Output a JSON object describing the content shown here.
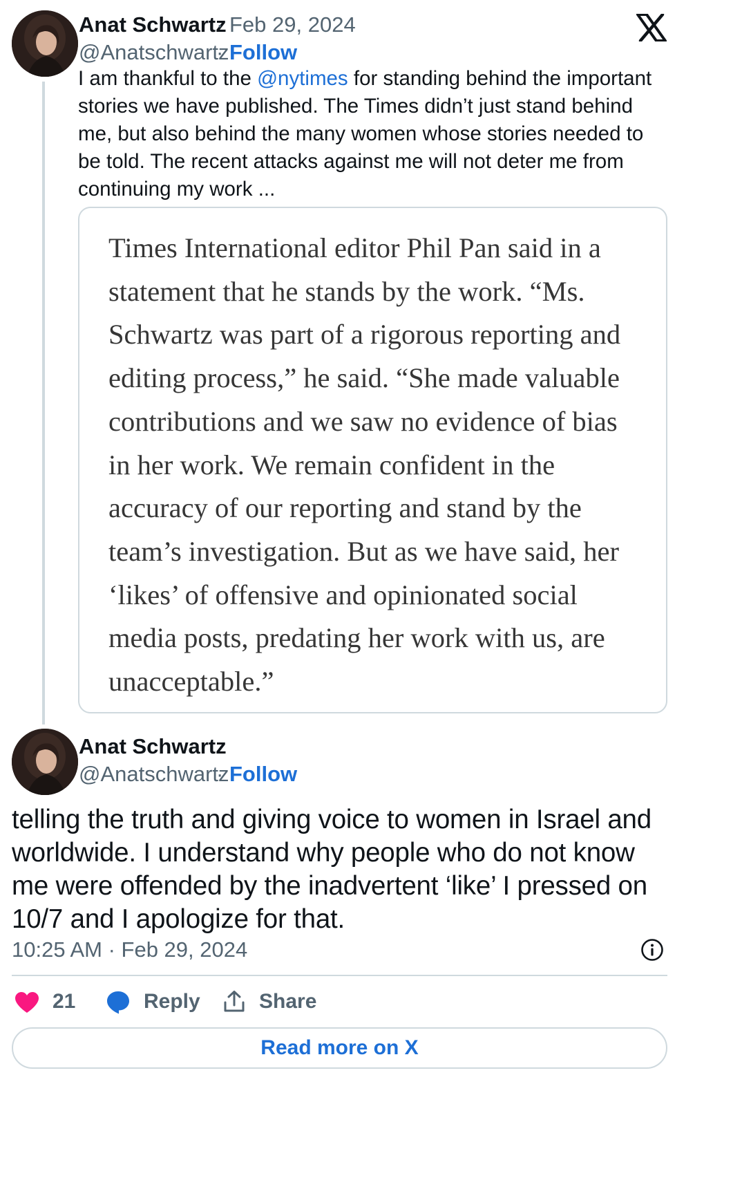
{
  "tweet1": {
    "author_name": "Anat Schwartz",
    "date": "Feb 29, 2024",
    "handle": "@Anatschwartz",
    "follow_label": "Follow",
    "text_before_mention": "I am thankful to the ",
    "mention": "@nytimes",
    "text_after_mention": " for standing behind the important stories we have published. The Times didn’t just stand behind me, but also behind the many women whose stories needed to be told. The recent attacks against me will not deter me from continuing my work ...",
    "quote_image_text": "Times International editor Phil Pan said in a statement that he stands by the work. “Ms. Schwartz was part of a rigorous reporting and editing process,” he said. “She made valuable contributions and we saw no evidence of bias in her work. We remain confident in the accuracy of our reporting and stand by the team’s investigation. But as we have said, her ‘likes’ of offensive and opinionated social media posts, predating her work with us, are unacceptable.”"
  },
  "tweet2": {
    "author_name": "Anat Schwartz",
    "handle": "@Anatschwartz",
    "follow_label": "Follow",
    "text": "telling the truth and giving voice to women in Israel and worldwide. I understand why people who do not know me were offended by the inadvertent ‘like’ I pressed on 10/7 and I apologize for that.",
    "timestamp": "10:25 AM · Feb 29, 2024"
  },
  "actions": {
    "like_count": "21",
    "reply_label": "Reply",
    "share_label": "Share",
    "read_more_label": "Read more on X"
  },
  "separator": "·",
  "icons": {
    "brand": "x-logo-icon",
    "info": "info-icon",
    "like": "heart-icon",
    "reply": "reply-bubble-icon",
    "share": "share-upload-icon"
  },
  "colors": {
    "link": "#1d6fd6",
    "heart": "#f91880",
    "secondary_text": "#536471",
    "border": "#cfd9de"
  }
}
